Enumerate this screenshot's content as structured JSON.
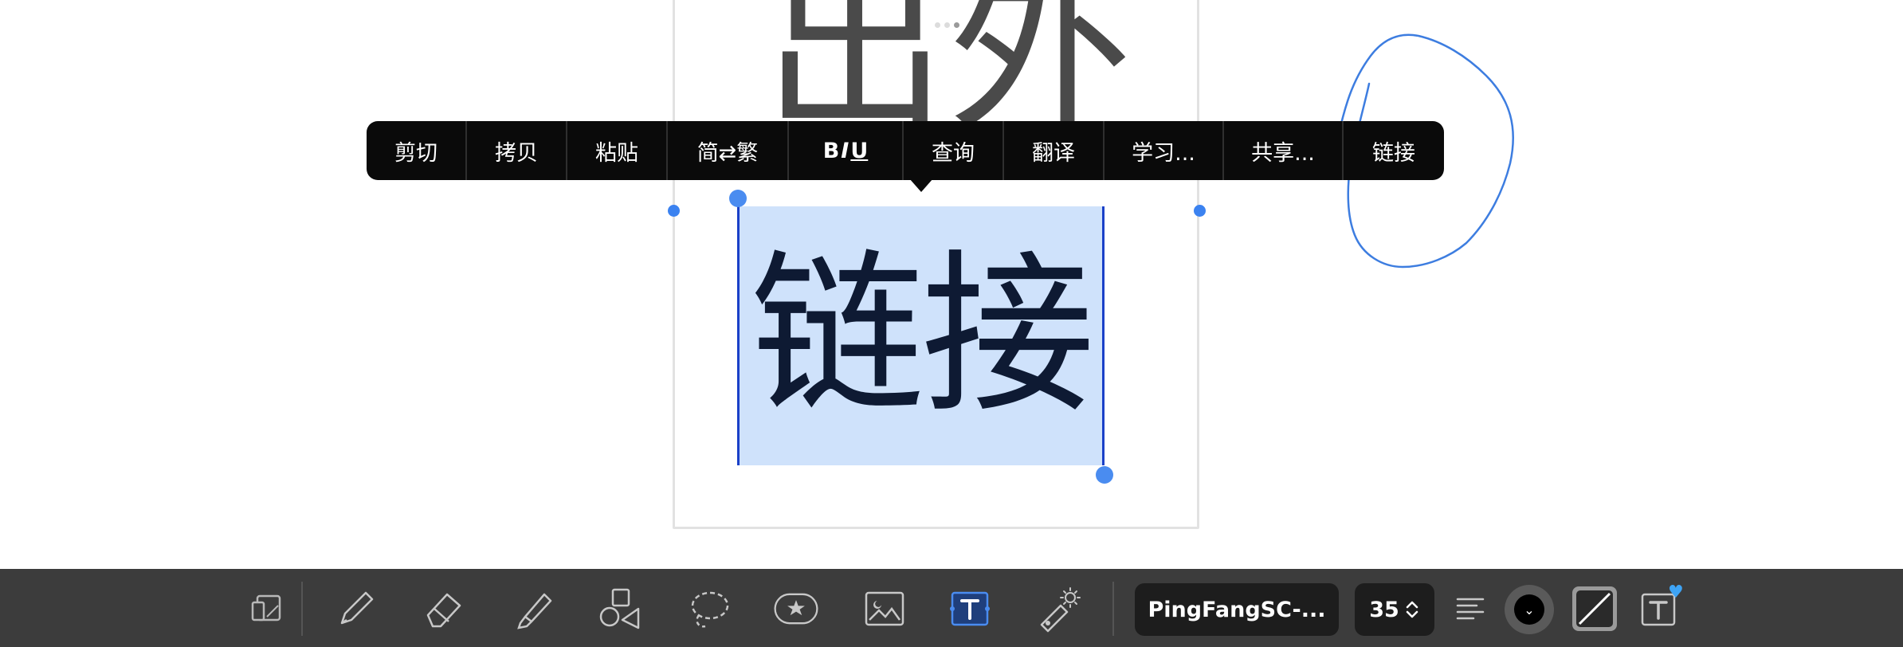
{
  "canvas": {
    "background_text": "出外",
    "selected_text": "链接"
  },
  "context_menu": {
    "items": [
      {
        "label": "剪切"
      },
      {
        "label": "拷贝"
      },
      {
        "label": "粘贴"
      },
      {
        "label": "简⇄繁"
      },
      {
        "label_b": "B",
        "label_i": "I",
        "label_u": "U"
      },
      {
        "label": "查询"
      },
      {
        "label": "翻译"
      },
      {
        "label": "学习..."
      },
      {
        "label": "共享..."
      },
      {
        "label": "链接"
      }
    ]
  },
  "toolbar": {
    "tools": [
      {
        "icon": "page-view-icon"
      },
      {
        "icon": "pen-icon"
      },
      {
        "icon": "eraser-icon"
      },
      {
        "icon": "highlighter-icon"
      },
      {
        "icon": "shapes-icon"
      },
      {
        "icon": "lasso-icon"
      },
      {
        "icon": "sticker-icon"
      },
      {
        "icon": "image-icon"
      },
      {
        "icon": "text-tool-icon",
        "active": true
      },
      {
        "icon": "laser-pointer-icon"
      }
    ],
    "font_name": "PingFangSC-...",
    "font_size": "35",
    "text_color": "#000000",
    "accent_color": "#3b82f0",
    "selection_color": "#cfe2fb"
  }
}
